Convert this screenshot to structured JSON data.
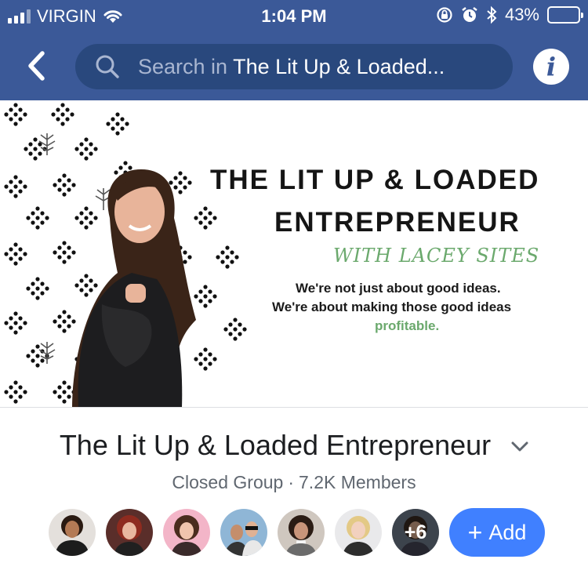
{
  "status_bar": {
    "carrier": "VIRGIN",
    "time": "1:04 PM",
    "battery": "43%",
    "battery_level": 0.43,
    "icons": [
      "signal-icon",
      "wifi-icon",
      "orientation-lock-icon",
      "alarm-icon",
      "bluetooth-icon",
      "battery-icon"
    ]
  },
  "nav": {
    "back_icon": "chevron-left-icon",
    "search_placeholder_prefix": "Search in ",
    "search_group": "The Lit Up & Loaded...",
    "info_icon": "info-icon",
    "info_glyph": "i",
    "bar_color": "#3b5998"
  },
  "cover": {
    "title_line1": "THE LIT UP & LOADED",
    "title_line2": "ENTREPRENEUR",
    "with_line": "WITH LACEY SITES",
    "tagline_line1": "We're not just about good ideas.",
    "tagline_line2": "We're about making those good ideas",
    "tagline_line3": "profitable.",
    "accent_color": "#6ba96d"
  },
  "group": {
    "name": "The Lit Up & Loaded Entrepreneur",
    "privacy": "Closed Group",
    "separator": "·",
    "members": "7.2K Members"
  },
  "member_avatars": {
    "more_label": "+6",
    "add_label": "Add",
    "add_glyph": "+",
    "add_color": "#4080ff"
  }
}
